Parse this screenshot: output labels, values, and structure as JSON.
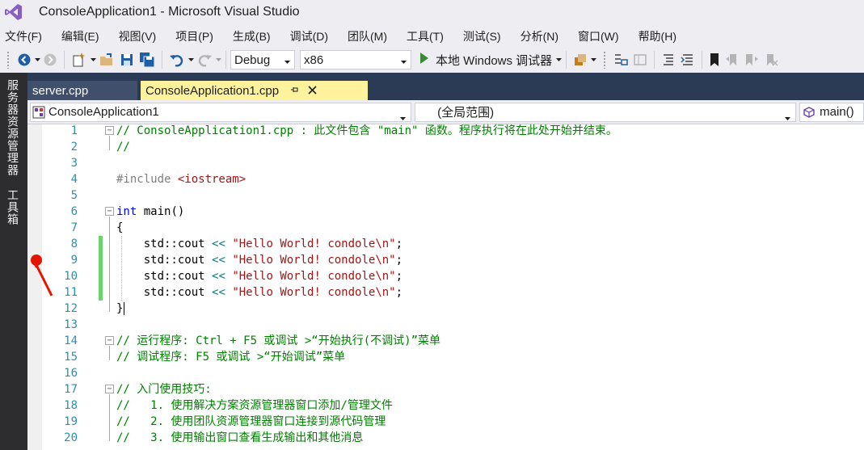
{
  "window": {
    "title": "ConsoleApplication1 - Microsoft Visual Studio",
    "logo_icon": "visual-studio-logo-icon"
  },
  "menu": [
    "文件(F)",
    "编辑(E)",
    "视图(V)",
    "项目(P)",
    "生成(B)",
    "调试(D)",
    "团队(M)",
    "工具(T)",
    "测试(S)",
    "分析(N)",
    "窗口(W)",
    "帮助(H)"
  ],
  "toolbar": {
    "configuration": "Debug",
    "platform": "x86",
    "run_label": "本地 Windows 调试器"
  },
  "side_tabs": [
    "服务器资源管理器",
    "工具箱"
  ],
  "tabs": [
    {
      "label": "server.cpp",
      "active": false
    },
    {
      "label": "ConsoleApplication1.cpp",
      "active": true,
      "pin_icon": "⊣",
      "close_icon": "✕"
    }
  ],
  "navbar": {
    "project": "ConsoleApplication1",
    "scope": "(全局范围)",
    "member": "main()"
  },
  "colors": {
    "active_tab": "#fff29d",
    "tab_strip": "#2b3a55",
    "comment": "#008000",
    "keyword": "#0000ff",
    "string": "#a31515",
    "line_number": "#2b91af",
    "change_bar": "#6bd36b",
    "breakpoint": "#e51400"
  },
  "code_lines": [
    {
      "n": "1",
      "fold": "−",
      "parts": [
        [
          "c-com",
          "// ConsoleApplication1.cpp : 此文件包含 \"main\" 函数。程序执行将在此处开始并结束。"
        ]
      ]
    },
    {
      "n": "2",
      "parts": [
        [
          "c-com",
          "//"
        ]
      ]
    },
    {
      "n": "3",
      "parts": []
    },
    {
      "n": "4",
      "parts": [
        [
          "c-pre",
          "#include "
        ],
        [
          "c-str",
          "<iostream>"
        ]
      ]
    },
    {
      "n": "5",
      "parts": []
    },
    {
      "n": "6",
      "fold": "−",
      "parts": [
        [
          "c-kw",
          "int"
        ],
        [
          "",
          " main()"
        ]
      ]
    },
    {
      "n": "7",
      "parts": [
        [
          "",
          "{"
        ]
      ]
    },
    {
      "n": "8",
      "changed": true,
      "parts": [
        [
          "",
          "    std::cout "
        ],
        [
          "c-op",
          "<<"
        ],
        [
          "",
          " "
        ],
        [
          "c-str",
          "\"Hello World! condole\\n\""
        ],
        [
          "",
          ";"
        ]
      ]
    },
    {
      "n": "9",
      "changed": true,
      "parts": [
        [
          "",
          "    std::cout "
        ],
        [
          "c-op",
          "<<"
        ],
        [
          "",
          " "
        ],
        [
          "c-str",
          "\"Hello World! condole\\n\""
        ],
        [
          "",
          ";"
        ]
      ]
    },
    {
      "n": "10",
      "changed": true,
      "parts": [
        [
          "",
          "    std::cout "
        ],
        [
          "c-op",
          "<<"
        ],
        [
          "",
          " "
        ],
        [
          "c-str",
          "\"Hello World! condole\\n\""
        ],
        [
          "",
          ";"
        ]
      ]
    },
    {
      "n": "11",
      "changed": true,
      "parts": [
        [
          "",
          "    std::cout "
        ],
        [
          "c-op",
          "<<"
        ],
        [
          "",
          " "
        ],
        [
          "c-str",
          "\"Hello World! condole\\n\""
        ],
        [
          "",
          ";"
        ]
      ]
    },
    {
      "n": "12",
      "parts": [
        [
          "",
          "}"
        ]
      ]
    },
    {
      "n": "13",
      "parts": []
    },
    {
      "n": "14",
      "fold": "−",
      "parts": [
        [
          "c-com",
          "// 运行程序: Ctrl + F5 或调试 >“开始执行(不调试)”菜单"
        ]
      ]
    },
    {
      "n": "15",
      "parts": [
        [
          "c-com",
          "// 调试程序: F5 或调试 >“开始调试”菜单"
        ]
      ]
    },
    {
      "n": "16",
      "parts": []
    },
    {
      "n": "17",
      "fold": "−",
      "parts": [
        [
          "c-com",
          "// 入门使用技巧:"
        ]
      ]
    },
    {
      "n": "18",
      "parts": [
        [
          "c-com",
          "//   1. 使用解决方案资源管理器窗口添加/管理文件"
        ]
      ]
    },
    {
      "n": "19",
      "parts": [
        [
          "c-com",
          "//   2. 使用团队资源管理器窗口连接到源代码管理"
        ]
      ]
    },
    {
      "n": "20",
      "parts": [
        [
          "c-com",
          "//   3. 使用输出窗口查看生成输出和其他消息"
        ]
      ]
    }
  ]
}
